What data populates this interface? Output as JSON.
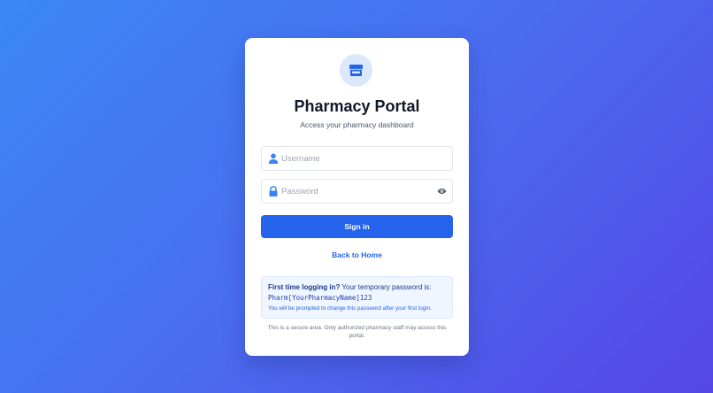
{
  "login": {
    "title": "Pharmacy Portal",
    "subtitle": "Access your pharmacy dashboard",
    "username_placeholder": "Username",
    "password_placeholder": "Password",
    "signin_label": "Sign in",
    "back_label": "Back to Home",
    "logo_icon": "store-icon"
  },
  "info": {
    "heading": "First time logging in?",
    "text": " Your temporary password is:",
    "code": "Pharm[YourPharmacyName]123",
    "note": "You will be prompted to change this password after your first login."
  },
  "footer": {
    "text": "This is a secure area. Only authorized pharmacy staff may access this portal."
  },
  "colors": {
    "primary": "#2563eb",
    "bg_start": "#3b87f5",
    "bg_end": "#5546e6"
  }
}
